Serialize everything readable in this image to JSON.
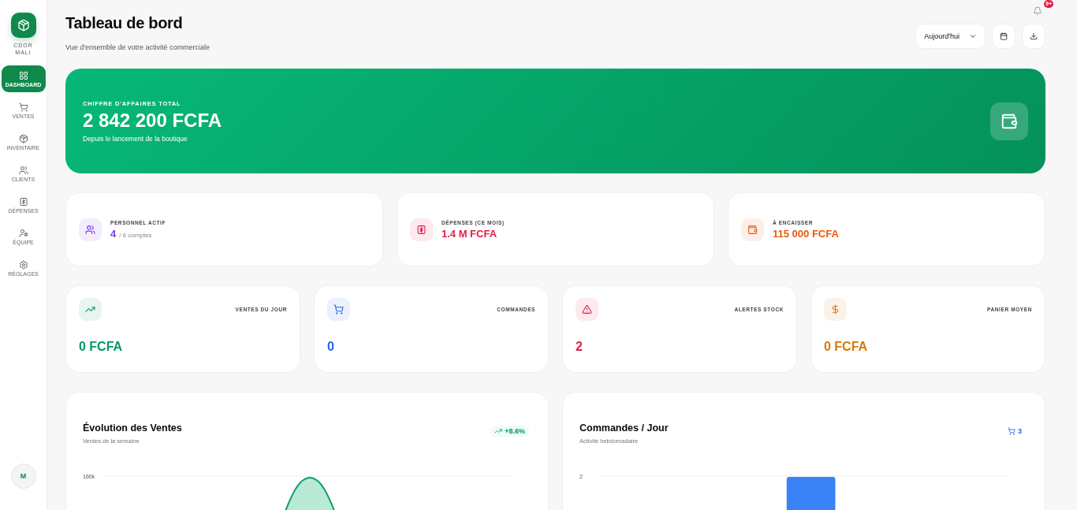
{
  "sidebar": {
    "brand_lines": [
      "CDOR",
      "MALI"
    ],
    "items": [
      {
        "kind": "dashboard",
        "label": "DASHBOARD",
        "selected": true
      },
      {
        "kind": "sales",
        "label": "VENTES",
        "selected": false
      },
      {
        "kind": "inventory",
        "label": "INVENTAIRE",
        "selected": false
      },
      {
        "kind": "clients",
        "label": "CLIENTS",
        "selected": false
      },
      {
        "kind": "expenses",
        "label": "DÉPENSES",
        "selected": false
      },
      {
        "kind": "team",
        "label": "ÉQUIPE",
        "selected": false
      },
      {
        "kind": "settings",
        "label": "RÉGLAGES",
        "selected": false
      }
    ],
    "avatar": "M"
  },
  "header": {
    "title": "Tableau de bord",
    "subtitle": "Vue d'ensemble de votre activité commerciale",
    "period_select": "Aujourd'hui",
    "notification_badge": "9+"
  },
  "hero": {
    "label": "CHIFFRE D'AFFAIRES TOTAL",
    "value": "2 842 200 FCFA",
    "caption": "Depuis le lancement de la boutique"
  },
  "stats": [
    {
      "kind": "staff",
      "label": "PERSONNEL ACTIF",
      "value": "4",
      "suffix": "/ 6 comptes",
      "color": "#7c3aed"
    },
    {
      "kind": "expenses",
      "label": "DÉPENSES (CE MOIS)",
      "value": "1.4 M FCFA",
      "color": "#e11d48"
    },
    {
      "kind": "receivable",
      "label": "À ENCAISSER",
      "value": "115 000 FCFA",
      "color": "#ea580c"
    }
  ],
  "kpis": [
    {
      "kind": "trend",
      "label": "VENTES DU JOUR",
      "value": "0 FCFA",
      "color": "#059669"
    },
    {
      "kind": "cart",
      "label": "COMMANDES",
      "value": "0",
      "color": "#2563eb"
    },
    {
      "kind": "alert",
      "label": "ALERTES STOCK",
      "value": "2",
      "color": "#e11d48"
    },
    {
      "kind": "dollar",
      "label": "PANIER MOYEN",
      "value": "0 FCFA",
      "color": "#d97706"
    }
  ],
  "charts": [
    {
      "kind": "area",
      "title": "Évolution des Ventes",
      "subtitle": "Ventes de la semaine",
      "badge": "+8.6%",
      "y_tick": "160k"
    },
    {
      "kind": "bar",
      "title": "Commandes / Jour",
      "subtitle": "Activité hebdomadaire",
      "badge": "3",
      "y_tick": "2"
    }
  ]
}
